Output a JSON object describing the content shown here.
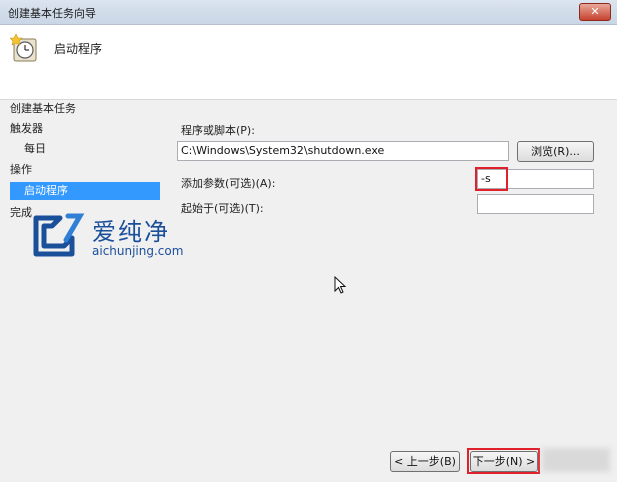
{
  "window": {
    "title": "创建基本任务向导",
    "close_glyph": "✕"
  },
  "header": {
    "title": "启动程序",
    "icon": "clock-icon"
  },
  "steps": {
    "create": "创建基本任务",
    "trigger": "触发器",
    "daily": "每日",
    "action": "操作",
    "start_program": "启动程序",
    "finish": "完成"
  },
  "form": {
    "program_label": "程序或脚本(P):",
    "program_value": "C:\\Windows\\System32\\shutdown.exe",
    "browse_label": "浏览(R)...",
    "args_label": "添加参数(可选)(A):",
    "args_value": "-s",
    "start_in_label": "起始于(可选)(T):",
    "start_in_value": ""
  },
  "footer": {
    "back_label": "< 上一步(B)",
    "next_label": "下一步(N) >"
  },
  "watermark": {
    "title": "爱纯净",
    "url": "aichunjing.com"
  },
  "colors": {
    "selection": "#3399ff",
    "highlight_border": "#e0202a",
    "brand": "#1a4f9a"
  }
}
